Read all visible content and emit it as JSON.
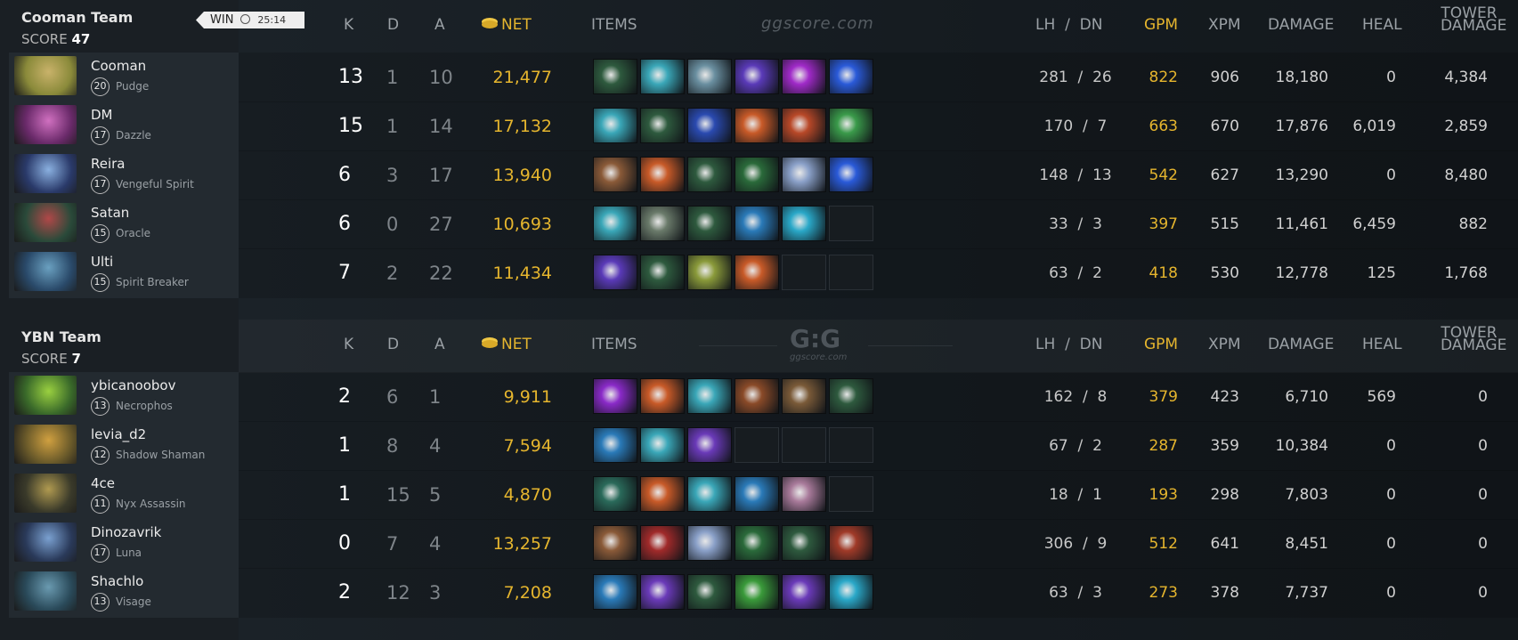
{
  "match": {
    "result": "WIN",
    "duration": "25:14"
  },
  "watermarks": {
    "top": "ggscore.com",
    "logo": "G:G",
    "logo_sub": "ggscore.com"
  },
  "columns": {
    "k": "K",
    "d": "D",
    "a": "A",
    "net": "NET",
    "items": "ITEMS",
    "lh": "LH",
    "dn": "DN",
    "gpm": "GPM",
    "xpm": "XPM",
    "damage": "DAMAGE",
    "heal": "HEAL",
    "tower1": "TOWER",
    "tower2": "DAMAGE"
  },
  "teams": [
    {
      "name": "Cooman Team",
      "score_label": "SCORE",
      "score": "47",
      "players": [
        {
          "name": "Cooman",
          "level": "20",
          "hero": "Pudge",
          "k": "13",
          "d": "1",
          "a": "10",
          "net": "21,477",
          "items": [
            "#2e5a3e",
            "#3aa7b8",
            "#6a8fa0",
            "#5a3ab8",
            "#a02ac8",
            "#2a5ad8"
          ],
          "lh": "281",
          "dn": "26",
          "gpm": "822",
          "xpm": "906",
          "damage": "18,180",
          "heal": "0",
          "tower": "4,384",
          "portrait": [
            "#8a8a3a",
            "#c9b26a"
          ]
        },
        {
          "name": "DM",
          "level": "17",
          "hero": "Dazzle",
          "k": "15",
          "d": "1",
          "a": "14",
          "net": "17,132",
          "items": [
            "#3aa7b8",
            "#2e5a3e",
            "#2a4ab0",
            "#c85a28",
            "#b84828",
            "#3a9a4a"
          ],
          "lh": "170",
          "dn": "7",
          "gpm": "663",
          "xpm": "670",
          "damage": "17,876",
          "heal": "6,019",
          "tower": "2,859",
          "portrait": [
            "#6a2a6a",
            "#d070c0"
          ]
        },
        {
          "name": "Reira",
          "level": "17",
          "hero": "Vengeful Spirit",
          "k": "6",
          "d": "3",
          "a": "17",
          "net": "13,940",
          "items": [
            "#8a5a38",
            "#c85a28",
            "#2e5a3e",
            "#2a6a3a",
            "#8aa0c8",
            "#2a5ad8"
          ],
          "lh": "148",
          "dn": "13",
          "gpm": "542",
          "xpm": "627",
          "damage": "13,290",
          "heal": "0",
          "tower": "8,480",
          "portrait": [
            "#2a3a6a",
            "#8ab0e0"
          ]
        },
        {
          "name": "Satan",
          "level": "15",
          "hero": "Oracle",
          "k": "6",
          "d": "0",
          "a": "27",
          "net": "10,693",
          "items": [
            "#3aa7b8",
            "#6a7a6a",
            "#2e5a3e",
            "#2a7ab8",
            "#2aa8c8",
            ""
          ],
          "lh": "33",
          "dn": "3",
          "gpm": "397",
          "xpm": "515",
          "damage": "11,461",
          "heal": "6,459",
          "tower": "882",
          "portrait": [
            "#2a4a3a",
            "#b04848"
          ]
        },
        {
          "name": "Ulti",
          "level": "15",
          "hero": "Spirit Breaker",
          "k": "7",
          "d": "2",
          "a": "22",
          "net": "11,434",
          "items": [
            "#5a3ab8",
            "#2e5a3e",
            "#8a9a3a",
            "#c85a28",
            "",
            ""
          ],
          "lh": "63",
          "dn": "2",
          "gpm": "418",
          "xpm": "530",
          "damage": "12,778",
          "heal": "125",
          "tower": "1,768",
          "portrait": [
            "#2a4a6a",
            "#6aa0c0"
          ]
        }
      ]
    },
    {
      "name": "YBN Team",
      "score_label": "SCORE",
      "score": "7",
      "players": [
        {
          "name": "ybicanoobov",
          "level": "13",
          "hero": "Necrophos",
          "k": "2",
          "d": "6",
          "a": "1",
          "net": "9,911",
          "items": [
            "#8a2ac8",
            "#c85a28",
            "#3aa7b8",
            "#8a4a28",
            "#7a5a38",
            "#2e5a3e"
          ],
          "lh": "162",
          "dn": "8",
          "gpm": "379",
          "xpm": "423",
          "damage": "6,710",
          "heal": "569",
          "tower": "0",
          "portrait": [
            "#3a6a2a",
            "#9ad040"
          ]
        },
        {
          "name": "levia_d2",
          "level": "12",
          "hero": "Shadow Shaman",
          "k": "1",
          "d": "8",
          "a": "4",
          "net": "7,594",
          "items": [
            "#2a7ab8",
            "#3aa7b8",
            "#6a3ab8",
            "",
            "",
            ""
          ],
          "lh": "67",
          "dn": "2",
          "gpm": "287",
          "xpm": "359",
          "damage": "10,384",
          "heal": "0",
          "tower": "0",
          "portrait": [
            "#6a5a2a",
            "#d0a040"
          ]
        },
        {
          "name": "4ce",
          "level": "11",
          "hero": "Nyx Assassin",
          "k": "1",
          "d": "15",
          "a": "5",
          "net": "4,870",
          "items": [
            "#2a6a5a",
            "#c85a28",
            "#3aa7b8",
            "#2a7ab8",
            "#a87a9a",
            ""
          ],
          "lh": "18",
          "dn": "1",
          "gpm": "193",
          "xpm": "298",
          "damage": "7,803",
          "heal": "0",
          "tower": "0",
          "portrait": [
            "#3a3a2a",
            "#b09a50"
          ]
        },
        {
          "name": "Dinozavrik",
          "level": "17",
          "hero": "Luna",
          "k": "0",
          "d": "7",
          "a": "4",
          "net": "13,257",
          "items": [
            "#8a5a38",
            "#a02a2a",
            "#8aa0c8",
            "#2a6a3a",
            "#2e5a3e",
            "#a03a28"
          ],
          "lh": "306",
          "dn": "9",
          "gpm": "512",
          "xpm": "641",
          "damage": "8,451",
          "heal": "0",
          "tower": "0",
          "portrait": [
            "#2a3a5a",
            "#7aa0d0"
          ]
        },
        {
          "name": "Shachlo",
          "level": "13",
          "hero": "Visage",
          "k": "2",
          "d": "12",
          "a": "3",
          "net": "7,208",
          "items": [
            "#2a7ab8",
            "#6a3ab8",
            "#2e5a3e",
            "#3a9a3a",
            "#6a3ab8",
            "#2aa8c8"
          ],
          "lh": "63",
          "dn": "3",
          "gpm": "273",
          "xpm": "378",
          "damage": "7,737",
          "heal": "0",
          "tower": "0",
          "portrait": [
            "#2a4a5a",
            "#6a9ab0"
          ]
        }
      ]
    }
  ]
}
